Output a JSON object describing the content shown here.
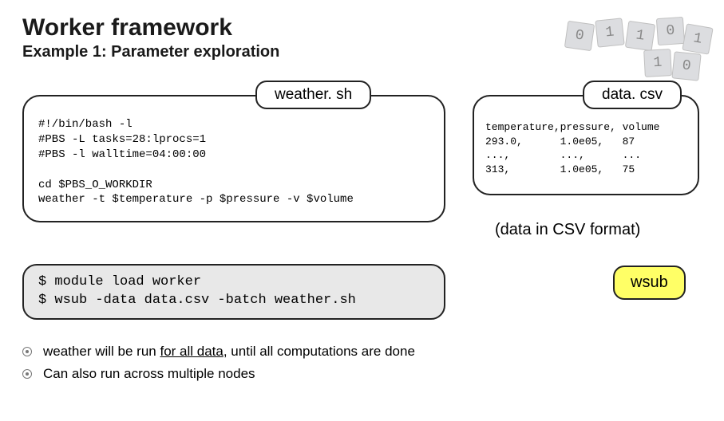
{
  "header": {
    "title": "Worker framework",
    "subtitle": "Example 1: Parameter exploration"
  },
  "tabs": {
    "weather": "weather. sh",
    "data": "data. csv"
  },
  "script_box": "#!/bin/bash -l\n#PBS -L tasks=28:lprocs=1\n#PBS -l walltime=04:00:00\n\ncd $PBS_O_WORKDIR\nweather -t $temperature -p $pressure -v $volume",
  "csv_box": "temperature,pressure, volume\n293.0,      1.0e05,   87\n...,        ...,      ...\n313,        1.0e05,   75",
  "csv_note": "(data in CSV format)",
  "cmd_box": "$ module load worker\n$ wsub -data data.csv -batch weather.sh",
  "wsub_label": "wsub",
  "bullets": {
    "b1_pre": "weather will be run ",
    "b1_u": "for all data",
    "b1_post": ", until all computations are done",
    "b2": "Can also run across multiple nodes"
  },
  "cubes": [
    "0",
    "1",
    "1",
    "0",
    "1",
    "1",
    "0"
  ]
}
